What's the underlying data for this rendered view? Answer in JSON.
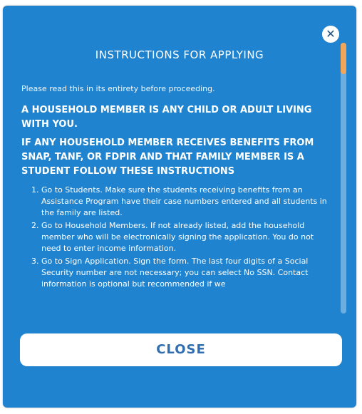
{
  "modal": {
    "title": "INSTRUCTIONS FOR APPLYING",
    "close_icon": "close-icon",
    "intro": "Please read this in its entirety before proceeding.",
    "heading1": "A HOUSEHOLD MEMBER IS ANY CHILD OR ADULT LIVING WITH YOU.",
    "heading2": "IF ANY HOUSEHOLD MEMBER RECEIVES BENEFITS FROM SNAP, TANF, OR FDPIR AND THAT FAMILY MEMBER IS A STUDENT FOLLOW THESE INSTRUCTIONS",
    "steps": [
      "Go to Students. Make sure the students receiving benefits from an Assistance Program have their case numbers entered and all students in the family are listed.",
      "Go to Household Members. If not already listed, add the household member who will be electronically signing the application. You do not need to enter income information.",
      "Go to Sign Application. Sign the form. The last four digits of a Social Security number are not necessary; you can select No SSN. Contact information is optional but recommended if we"
    ],
    "close_button": "CLOSE"
  },
  "colors": {
    "modal_bg": "#1f83cf",
    "scroll_thumb": "#f2a65a",
    "button_text": "#2f6fb1"
  }
}
